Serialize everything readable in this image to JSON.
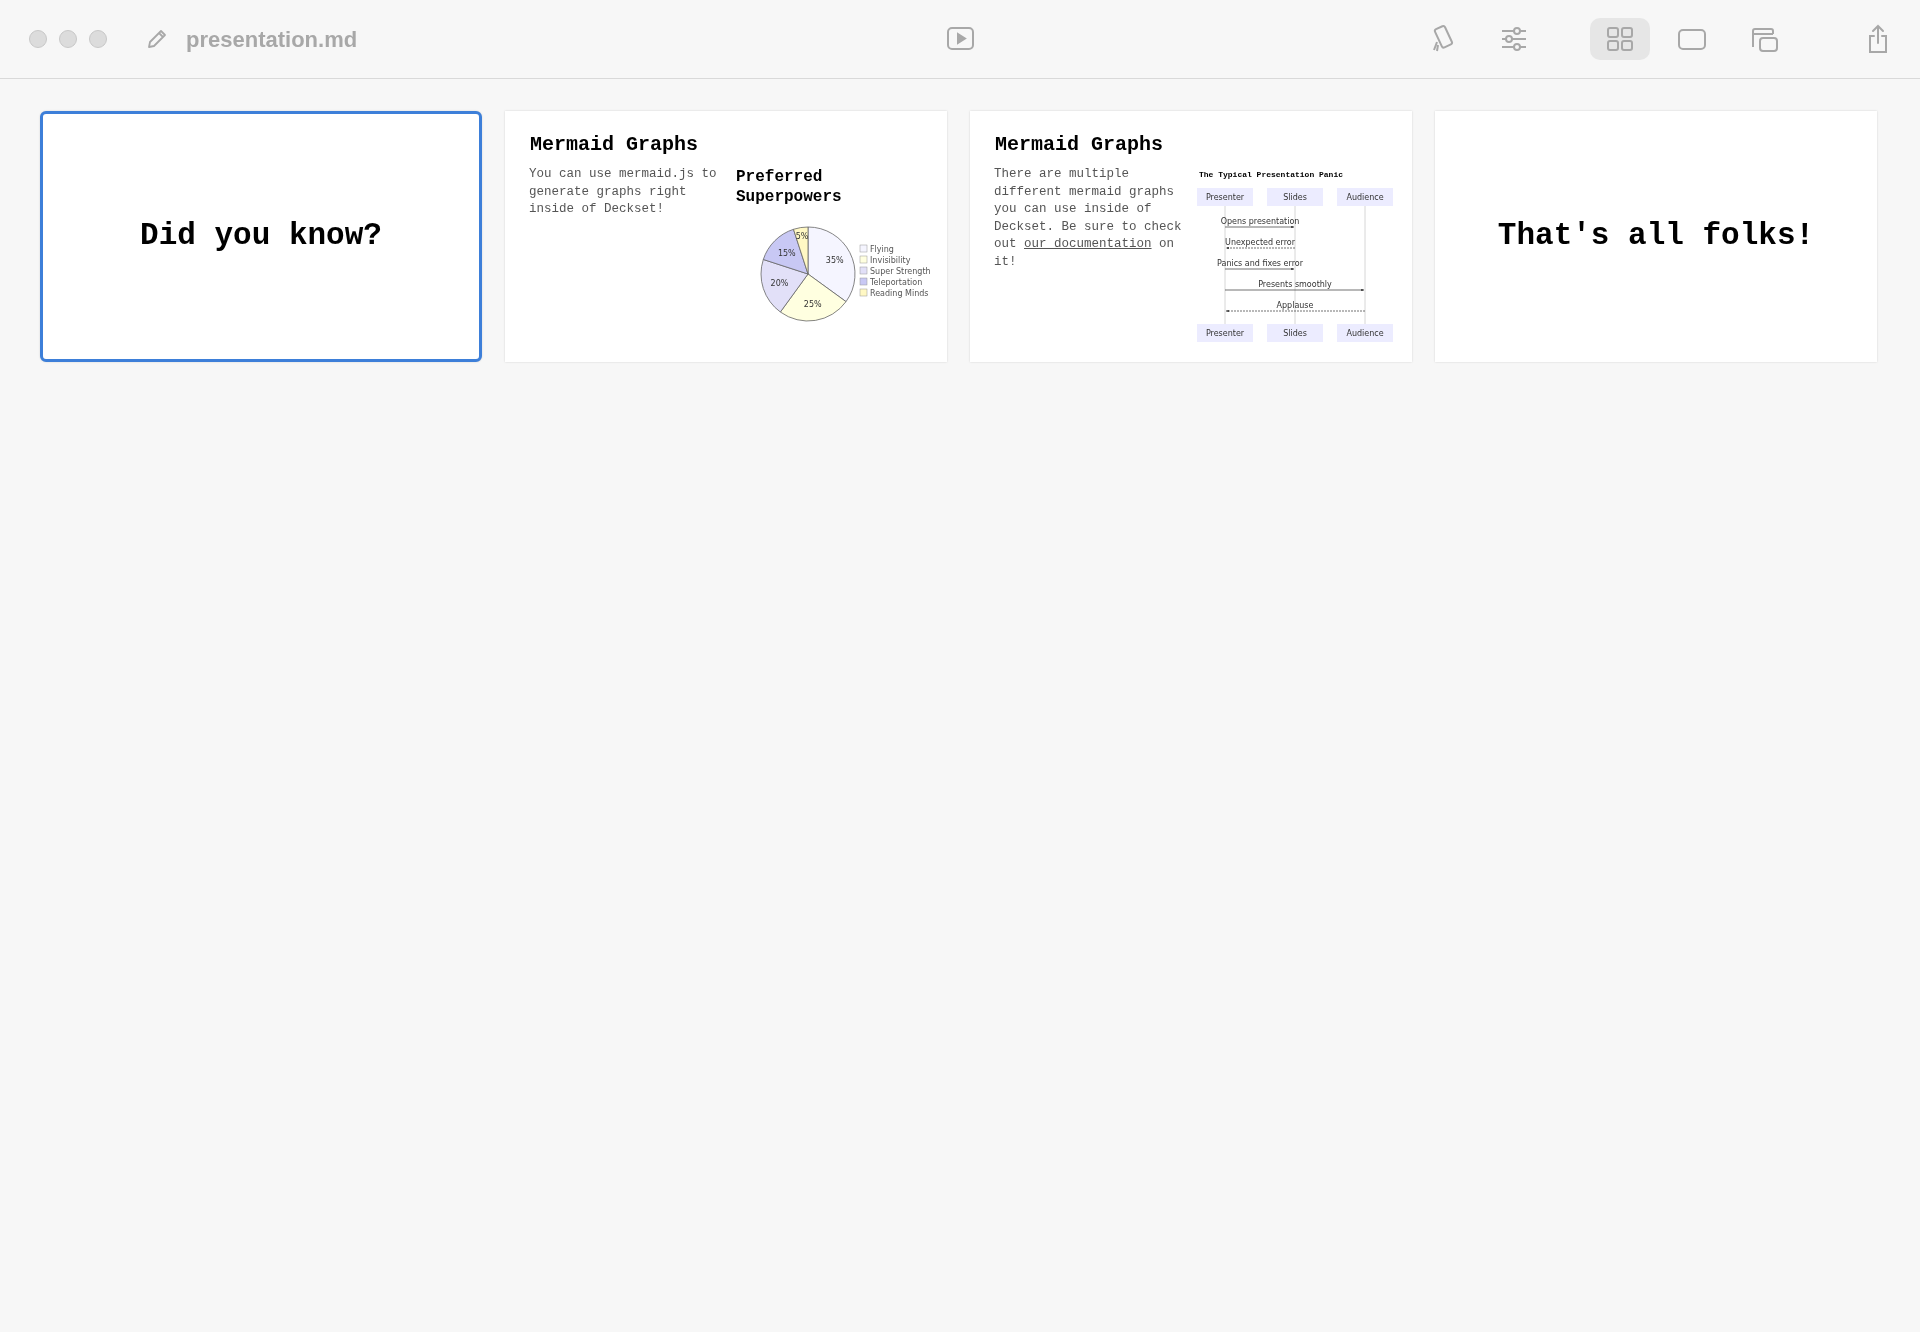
{
  "window": {
    "title": "presentation.md"
  },
  "toolbar": {
    "view_modes": [
      {
        "kind": "grid",
        "selected": true
      },
      {
        "kind": "single",
        "selected": false
      },
      {
        "kind": "presenter",
        "selected": false
      }
    ]
  },
  "slides": [
    {
      "kind": "title",
      "selected": true,
      "title": "Did you know?"
    },
    {
      "kind": "chart",
      "selected": false,
      "title": "Mermaid Graphs",
      "body": "You can use mermaid.js to generate graphs right inside of Deckset!",
      "chart_title": "Preferred Superpowers",
      "chart_data": {
        "type": "pie",
        "legend": "right",
        "categories": [
          "Flying",
          "Invisibility",
          "Super Strength",
          "Teleportation",
          "Reading Minds"
        ],
        "values": [
          35,
          25,
          20,
          15,
          5
        ],
        "value_labels": [
          "35%",
          "25%",
          "20%",
          "15%",
          "5%"
        ],
        "colors": [
          "#f5f5ff",
          "#ffffe0",
          "#e2e0f8",
          "#c8c8f4",
          "#fff8c4"
        ]
      }
    },
    {
      "kind": "diagram",
      "selected": false,
      "title": "Mermaid Graphs",
      "body_before": "There are multiple different mermaid graphs you can use inside of Deckset. Be sure to check out",
      "link": "our documentation",
      "body_after": "on it!",
      "diagram_title": "The Typical Presentation Panic",
      "participants": [
        "Presenter",
        "Slides",
        "Audience"
      ],
      "messages": [
        {
          "label": "Opens presentation",
          "kind": "request"
        },
        {
          "label": "Unexpected error",
          "kind": "reply"
        },
        {
          "label": "Panics and fixes error",
          "kind": "request"
        },
        {
          "label": "Presents smoothly",
          "kind": "broadcast"
        },
        {
          "label": "Applause",
          "kind": "response"
        }
      ],
      "participants_bottom": [
        "Presenter",
        "Slides",
        "Audience"
      ]
    },
    {
      "kind": "title",
      "selected": false,
      "title": "That's all folks!"
    }
  ]
}
